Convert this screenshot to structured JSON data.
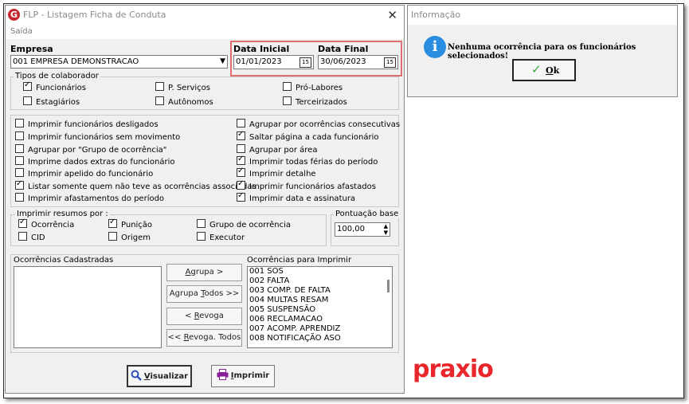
{
  "window": {
    "title": "FLP - Listagem Ficha de Conduta",
    "close_glyph": "✕",
    "menu": [
      "Saída"
    ]
  },
  "empresa": {
    "label": "Empresa",
    "value": "001 EMPRESA DEMONSTRACAO"
  },
  "datas": {
    "inicial_label": "Data Inicial",
    "inicial_value": "01/01/2023",
    "final_label": "Data Final",
    "final_value": "30/06/2023",
    "calendar_glyph": "15"
  },
  "tipos": {
    "label": "Tipos de colaborador",
    "items": [
      {
        "label": "Funcionários",
        "checked": true
      },
      {
        "label": "P. Serviços",
        "checked": false
      },
      {
        "label": "Pró-Labores",
        "checked": false
      },
      {
        "label": "Estagiários",
        "checked": false
      },
      {
        "label": "Autônomos",
        "checked": false
      },
      {
        "label": "Terceirizados",
        "checked": false
      }
    ]
  },
  "opcoes_esquerda": [
    {
      "label": "Imprimir funcionários desligados",
      "checked": false
    },
    {
      "label": "Imprimir funcionários sem movimento",
      "checked": false
    },
    {
      "label": "Agrupar por \"Grupo de ocorrência\"",
      "checked": false
    },
    {
      "label": "Imprime dados extras do funcionário",
      "checked": false
    },
    {
      "label": "Imprimir apelido do funcionário",
      "checked": false
    },
    {
      "label": "Listar somente quem não teve as ocorrências associadas",
      "checked": true
    },
    {
      "label": "Imprimir afastamentos do período",
      "checked": false
    }
  ],
  "opcoes_direita": [
    {
      "label": "Agrupar por ocorrências consecutivas",
      "checked": false
    },
    {
      "label": "Saltar página a cada funcionário",
      "checked": true
    },
    {
      "label": "Agrupar por área",
      "checked": false
    },
    {
      "label": "Imprimir todas férias do período",
      "checked": true
    },
    {
      "label": "Imprimir detalhe",
      "checked": true
    },
    {
      "label": "Imprimir funcionários afastados",
      "checked": true
    },
    {
      "label": "Imprimir data e assinatura",
      "checked": true
    }
  ],
  "resumos": {
    "label": "Imprimir resumos por :",
    "items": [
      {
        "label": "Ocorrência",
        "checked": true
      },
      {
        "label": "Punição",
        "checked": true
      },
      {
        "label": "Grupo de ocorrência",
        "checked": false
      },
      {
        "label": "CID",
        "checked": false
      },
      {
        "label": "Origem",
        "checked": false
      },
      {
        "label": "Executor",
        "checked": false
      }
    ]
  },
  "pontuacao": {
    "label": "Pontuação base",
    "value": "100,00"
  },
  "ocorrencias_cadastradas": {
    "label": "Ocorrências Cadastradas",
    "items": []
  },
  "ocorrencias_imprimir": {
    "label": "Ocorrências para Imprimir",
    "items": [
      "001 SOS",
      "002 FALTA",
      "003 COMP. DE FALTA",
      "004 MULTAS RESAM",
      "005 SUSPENSÃO",
      "006 RECLAMACAO",
      "007 ACOMP. APRENDIZ",
      "008 NOTIFICAÇÃO ASO"
    ]
  },
  "botoes_lista": {
    "agrupa": {
      "pre": "",
      "u": "A",
      "post": "grupa >"
    },
    "agrupa_todos": {
      "pre": "Agrupa ",
      "u": "T",
      "post": "odos >>"
    },
    "revoga": {
      "pre": "< ",
      "u": "R",
      "post": "evoga"
    },
    "revoga_todos": {
      "pre": "<< ",
      "u": "R",
      "post": "evoga. Todos"
    }
  },
  "botoes_acao": {
    "visualizar": {
      "u": "V",
      "post": "isualizar"
    },
    "imprimir": {
      "u": "I",
      "post": "mprimir"
    }
  },
  "info": {
    "title": "Informação",
    "icon_glyph": "i",
    "message": "Nenhuma ocorrência para os funcionários selecionados!",
    "ok": {
      "u": "O",
      "post": "k"
    },
    "ok_glyph": "✓"
  },
  "brand": {
    "logo_text": "praxio",
    "logo_color": "#e8262b"
  },
  "colors": {
    "highlight_border": "#e07070",
    "info_icon": "#2a8de0",
    "ok_check": "#3aa83a",
    "visualizar_icon": "#2c4fb8",
    "imprimir_icon": "#8a1f9a"
  }
}
